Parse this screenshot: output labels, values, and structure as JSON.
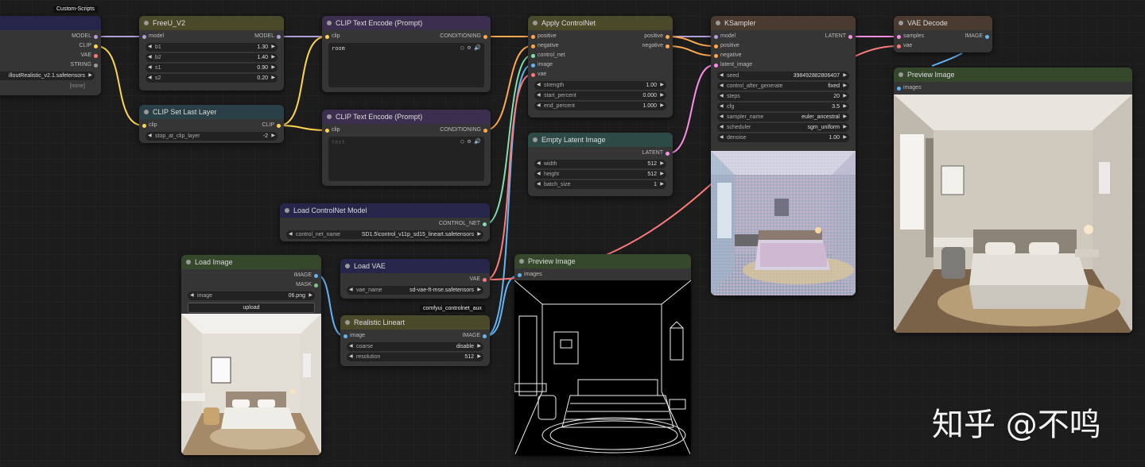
{
  "tags": {
    "custom_scripts": "Custom-Scripts",
    "controlnet_aux": "comfyui_controlnet_aux"
  },
  "checkpoint": {
    "outputs": [
      "MODEL",
      "CLIP",
      "VAE",
      "STRING"
    ],
    "ckpt_value": "illoutRealistic_v2.1.safetensors",
    "none_value": "[none]"
  },
  "freeu": {
    "title": "FreeU_V2",
    "input": "model",
    "output": "MODEL",
    "widgets": [
      {
        "label": "b1",
        "value": "1.30"
      },
      {
        "label": "b2",
        "value": "1.40"
      },
      {
        "label": "s1",
        "value": "0.90"
      },
      {
        "label": "s2",
        "value": "0.20"
      }
    ]
  },
  "clip_last": {
    "title": "CLIP Set Last Layer",
    "input": "clip",
    "output": "CLIP",
    "widget": {
      "label": "stop_at_clip_layer",
      "value": "-2"
    }
  },
  "clip_pos": {
    "title": "CLIP Text Encode (Prompt)",
    "input": "clip",
    "output": "CONDITIONING",
    "text": "room"
  },
  "clip_neg": {
    "title": "CLIP Text Encode (Prompt)",
    "input": "clip",
    "output": "CONDITIONING",
    "placeholder": "text"
  },
  "cnet_loader": {
    "title": "Load ControlNet Model",
    "output": "CONTROL_NET",
    "widget": {
      "label": "control_net_name",
      "value": "SD1.5\\control_v11p_sd15_lineart.safetensors"
    }
  },
  "apply_cnet": {
    "title": "Apply ControlNet",
    "inputs": [
      "positive",
      "negative",
      "control_net",
      "image",
      "vae"
    ],
    "outputs": [
      "positive",
      "negative"
    ],
    "widgets": [
      {
        "label": "strength",
        "value": "1.00"
      },
      {
        "label": "start_percent",
        "value": "0.000"
      },
      {
        "label": "end_percent",
        "value": "1.000"
      }
    ]
  },
  "empty_latent": {
    "title": "Empty Latent Image",
    "output": "LATENT",
    "widgets": [
      {
        "label": "width",
        "value": "512"
      },
      {
        "label": "height",
        "value": "512"
      },
      {
        "label": "batch_size",
        "value": "1"
      }
    ]
  },
  "ksampler": {
    "title": "KSampler",
    "inputs": [
      "model",
      "positive",
      "negative",
      "latent_image"
    ],
    "output": "LATENT",
    "widgets": [
      {
        "label": "seed",
        "value": "398492882806407"
      },
      {
        "label": "control_after_generate",
        "value": "fixed"
      },
      {
        "label": "steps",
        "value": "20"
      },
      {
        "label": "cfg",
        "value": "3.5"
      },
      {
        "label": "sampler_name",
        "value": "euler_ancestral"
      },
      {
        "label": "scheduler",
        "value": "sgm_uniform"
      },
      {
        "label": "denoise",
        "value": "1.00"
      }
    ]
  },
  "vae_decode": {
    "title": "VAE Decode",
    "inputs": [
      "samples",
      "vae"
    ],
    "output": "IMAGE"
  },
  "preview_right": {
    "title": "Preview Image",
    "input": "images"
  },
  "preview_mid": {
    "title": "Preview Image",
    "input": "images"
  },
  "load_image": {
    "title": "Load Image",
    "outputs": [
      "IMAGE",
      "MASK"
    ],
    "widget": {
      "label": "image",
      "value": "06.png"
    },
    "upload_label": "upload"
  },
  "load_vae": {
    "title": "Load VAE",
    "output": "VAE",
    "widget": {
      "label": "vae_name",
      "value": "sd-vae-ft-mse.safetensors"
    }
  },
  "lineart": {
    "title": "Realistic Lineart",
    "input": "image",
    "output": "IMAGE",
    "widgets": [
      {
        "label": "coarse",
        "value": "disable"
      },
      {
        "label": "resolution",
        "value": "512"
      }
    ]
  },
  "watermark": "知乎 @不鸣",
  "colors": {
    "model": "#b39ddb",
    "clip": "#ffd54f",
    "vae": "#ff7b7b",
    "conditioning": "#ffa94d",
    "control_net": "#7fe0b0",
    "image": "#64b5f6",
    "latent": "#ff8ee8"
  }
}
